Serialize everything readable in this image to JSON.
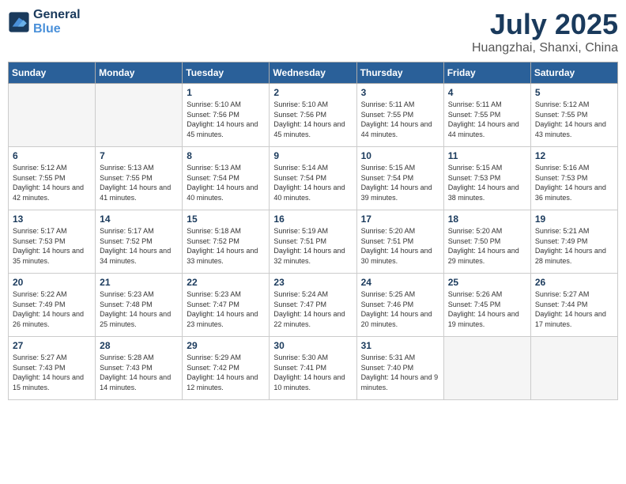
{
  "header": {
    "logo_line1": "General",
    "logo_line2": "Blue",
    "month_title": "July 2025",
    "subtitle": "Huangzhai, Shanxi, China"
  },
  "weekdays": [
    "Sunday",
    "Monday",
    "Tuesday",
    "Wednesday",
    "Thursday",
    "Friday",
    "Saturday"
  ],
  "weeks": [
    [
      {
        "day": "",
        "empty": true
      },
      {
        "day": "",
        "empty": true
      },
      {
        "day": "1",
        "sunrise": "5:10 AM",
        "sunset": "7:56 PM",
        "daylight": "14 hours and 45 minutes."
      },
      {
        "day": "2",
        "sunrise": "5:10 AM",
        "sunset": "7:56 PM",
        "daylight": "14 hours and 45 minutes."
      },
      {
        "day": "3",
        "sunrise": "5:11 AM",
        "sunset": "7:55 PM",
        "daylight": "14 hours and 44 minutes."
      },
      {
        "day": "4",
        "sunrise": "5:11 AM",
        "sunset": "7:55 PM",
        "daylight": "14 hours and 44 minutes."
      },
      {
        "day": "5",
        "sunrise": "5:12 AM",
        "sunset": "7:55 PM",
        "daylight": "14 hours and 43 minutes."
      }
    ],
    [
      {
        "day": "6",
        "sunrise": "5:12 AM",
        "sunset": "7:55 PM",
        "daylight": "14 hours and 42 minutes."
      },
      {
        "day": "7",
        "sunrise": "5:13 AM",
        "sunset": "7:55 PM",
        "daylight": "14 hours and 41 minutes."
      },
      {
        "day": "8",
        "sunrise": "5:13 AM",
        "sunset": "7:54 PM",
        "daylight": "14 hours and 40 minutes."
      },
      {
        "day": "9",
        "sunrise": "5:14 AM",
        "sunset": "7:54 PM",
        "daylight": "14 hours and 40 minutes."
      },
      {
        "day": "10",
        "sunrise": "5:15 AM",
        "sunset": "7:54 PM",
        "daylight": "14 hours and 39 minutes."
      },
      {
        "day": "11",
        "sunrise": "5:15 AM",
        "sunset": "7:53 PM",
        "daylight": "14 hours and 38 minutes."
      },
      {
        "day": "12",
        "sunrise": "5:16 AM",
        "sunset": "7:53 PM",
        "daylight": "14 hours and 36 minutes."
      }
    ],
    [
      {
        "day": "13",
        "sunrise": "5:17 AM",
        "sunset": "7:53 PM",
        "daylight": "14 hours and 35 minutes."
      },
      {
        "day": "14",
        "sunrise": "5:17 AM",
        "sunset": "7:52 PM",
        "daylight": "14 hours and 34 minutes."
      },
      {
        "day": "15",
        "sunrise": "5:18 AM",
        "sunset": "7:52 PM",
        "daylight": "14 hours and 33 minutes."
      },
      {
        "day": "16",
        "sunrise": "5:19 AM",
        "sunset": "7:51 PM",
        "daylight": "14 hours and 32 minutes."
      },
      {
        "day": "17",
        "sunrise": "5:20 AM",
        "sunset": "7:51 PM",
        "daylight": "14 hours and 30 minutes."
      },
      {
        "day": "18",
        "sunrise": "5:20 AM",
        "sunset": "7:50 PM",
        "daylight": "14 hours and 29 minutes."
      },
      {
        "day": "19",
        "sunrise": "5:21 AM",
        "sunset": "7:49 PM",
        "daylight": "14 hours and 28 minutes."
      }
    ],
    [
      {
        "day": "20",
        "sunrise": "5:22 AM",
        "sunset": "7:49 PM",
        "daylight": "14 hours and 26 minutes."
      },
      {
        "day": "21",
        "sunrise": "5:23 AM",
        "sunset": "7:48 PM",
        "daylight": "14 hours and 25 minutes."
      },
      {
        "day": "22",
        "sunrise": "5:23 AM",
        "sunset": "7:47 PM",
        "daylight": "14 hours and 23 minutes."
      },
      {
        "day": "23",
        "sunrise": "5:24 AM",
        "sunset": "7:47 PM",
        "daylight": "14 hours and 22 minutes."
      },
      {
        "day": "24",
        "sunrise": "5:25 AM",
        "sunset": "7:46 PM",
        "daylight": "14 hours and 20 minutes."
      },
      {
        "day": "25",
        "sunrise": "5:26 AM",
        "sunset": "7:45 PM",
        "daylight": "14 hours and 19 minutes."
      },
      {
        "day": "26",
        "sunrise": "5:27 AM",
        "sunset": "7:44 PM",
        "daylight": "14 hours and 17 minutes."
      }
    ],
    [
      {
        "day": "27",
        "sunrise": "5:27 AM",
        "sunset": "7:43 PM",
        "daylight": "14 hours and 15 minutes."
      },
      {
        "day": "28",
        "sunrise": "5:28 AM",
        "sunset": "7:43 PM",
        "daylight": "14 hours and 14 minutes."
      },
      {
        "day": "29",
        "sunrise": "5:29 AM",
        "sunset": "7:42 PM",
        "daylight": "14 hours and 12 minutes."
      },
      {
        "day": "30",
        "sunrise": "5:30 AM",
        "sunset": "7:41 PM",
        "daylight": "14 hours and 10 minutes."
      },
      {
        "day": "31",
        "sunrise": "5:31 AM",
        "sunset": "7:40 PM",
        "daylight": "14 hours and 9 minutes."
      },
      {
        "day": "",
        "empty": true
      },
      {
        "day": "",
        "empty": true
      }
    ]
  ]
}
